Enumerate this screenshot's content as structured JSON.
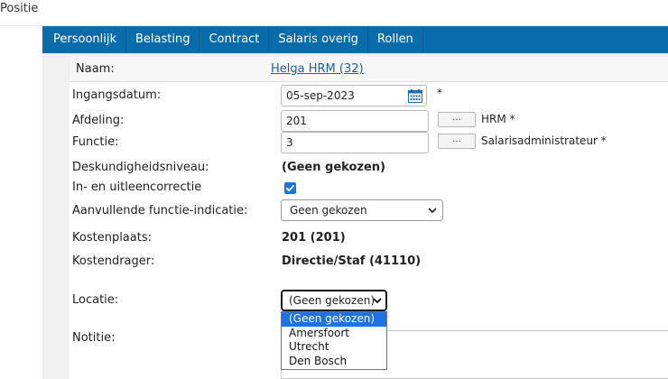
{
  "page": {
    "title": "Positie"
  },
  "tabs": [
    {
      "label": "Persoonlijk"
    },
    {
      "label": "Belasting"
    },
    {
      "label": "Contract"
    },
    {
      "label": "Salaris overig"
    },
    {
      "label": "Rollen"
    }
  ],
  "form": {
    "name": {
      "label": "Naam:",
      "value": "Helga HRM (32)"
    },
    "start_date": {
      "label": "Ingangsdatum:",
      "value": "05-sep-2023",
      "required": "*"
    },
    "department": {
      "label": "Afdeling:",
      "value": "201",
      "lookup_label": "...",
      "lookup_text": "HRM *"
    },
    "function": {
      "label": "Functie:",
      "value": "3",
      "lookup_label": "...",
      "lookup_text": "Salarisadministrateur *"
    },
    "expertise": {
      "label": "Deskundigheidsniveau:",
      "value": "(Geen gekozen)"
    },
    "correction": {
      "label": "In- en uitleencorrectie",
      "checked": true
    },
    "extra_function": {
      "label": "Aanvullende functie-indicatie:",
      "value": "Geen gekozen"
    },
    "cost_center": {
      "label": "Kostenplaats:",
      "value": "201 (201)"
    },
    "cost_bearer": {
      "label": "Kostendrager:",
      "value": "Directie/Staf (41110)"
    },
    "location": {
      "label": "Locatie:",
      "value": "(Geen gekozen)",
      "options": [
        "(Geen gekozen)",
        "Amersfoort",
        "Utrecht",
        "Den Bosch"
      ]
    },
    "notes": {
      "label": "Notitie:"
    }
  },
  "colors": {
    "tab_bar": "#0a6cab",
    "link": "#1a63a8",
    "selection": "#1a73e8",
    "panel_bg": "#f0f0f0"
  },
  "icons": {
    "calendar": "calendar-icon",
    "chevron": "chevron-down-icon",
    "check": "checkmark-icon"
  }
}
